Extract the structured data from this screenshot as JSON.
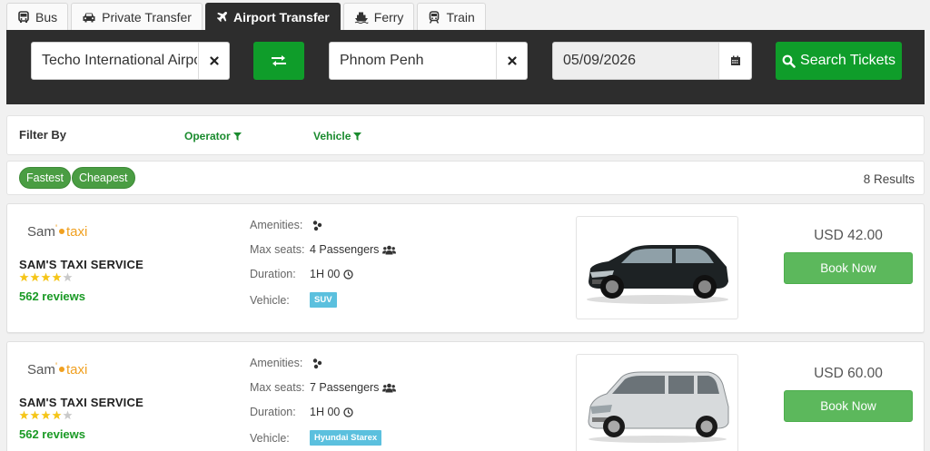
{
  "tabs": [
    {
      "label": "Bus",
      "icon": "bus-icon"
    },
    {
      "label": "Private Transfer",
      "icon": "taxi-icon"
    },
    {
      "label": "Airport Transfer",
      "icon": "plane-icon",
      "active": true
    },
    {
      "label": "Ferry",
      "icon": "ferry-icon"
    },
    {
      "label": "Train",
      "icon": "train-icon"
    }
  ],
  "search": {
    "from_value": "Techo International Airport",
    "to_value": "Phnom Penh",
    "date_value": "05/09/2026",
    "search_label": "Search Tickets"
  },
  "filter": {
    "label": "Filter By",
    "operator_label": "Operator",
    "vehicle_label": "Vehicle"
  },
  "sort": {
    "fastest_label": "Fastest",
    "cheapest_label": "Cheapest",
    "results_label": "8 Results"
  },
  "labels": {
    "amenities": "Amenities:",
    "max_seats": "Max seats:",
    "duration": "Duration:",
    "vehicle": "Vehicle:",
    "book_now": "Book Now"
  },
  "results": [
    {
      "logo_text": "Sam's taxi",
      "operator": "SAM'S TAXI SERVICE",
      "rating": 4,
      "reviews": "562 reviews",
      "seats": "4 Passengers",
      "duration": "1H 00",
      "vehicle": "SUV",
      "price": "USD 42.00",
      "image": "black-suv"
    },
    {
      "logo_text": "Sam's taxi",
      "operator": "SAM'S TAXI SERVICE",
      "rating": 4,
      "reviews": "562 reviews",
      "seats": "7 Passengers",
      "duration": "1H 00",
      "vehicle": "Hyundai Starex",
      "price": "USD 60.00",
      "image": "silver-van"
    }
  ],
  "colors": {
    "primary_green": "#0f9d2a",
    "button_green": "#5cb85c",
    "search_bg": "#2d2d2d",
    "badge_blue": "#5bc0de",
    "star_gold": "#f5c518"
  }
}
